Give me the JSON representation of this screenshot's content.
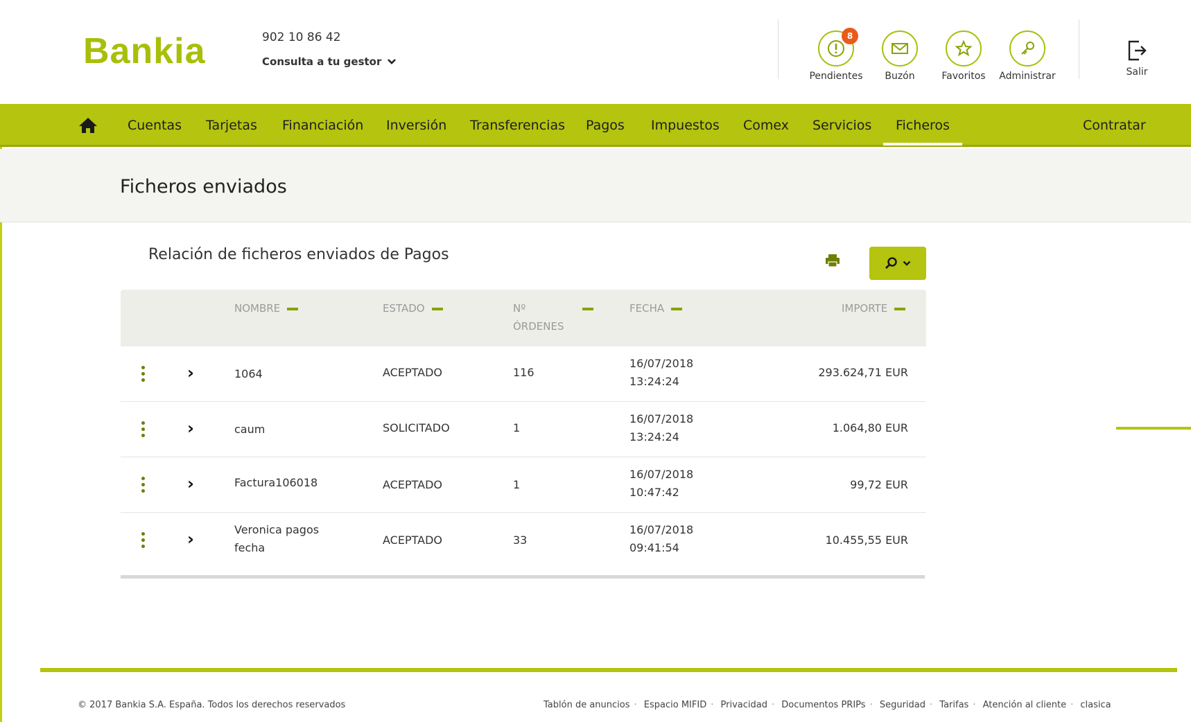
{
  "header": {
    "logo": "Bankia",
    "phone": "902 10 86 42",
    "gestor_label": "Consulta a tu gestor",
    "icons": [
      {
        "name": "pendientes-icon",
        "label": "Pendientes",
        "badge": "8"
      },
      {
        "name": "buzon-icon",
        "label": "Buzón"
      },
      {
        "name": "favoritos-icon",
        "label": "Favoritos"
      },
      {
        "name": "administrar-icon",
        "label": "Administrar"
      }
    ],
    "salir_label": "Salir"
  },
  "nav": {
    "items": [
      "Cuentas",
      "Tarjetas",
      "Financiación",
      "Inversión",
      "Transferencias",
      "Pagos",
      "Impuestos",
      "Comex",
      "Servicios",
      "Ficheros"
    ],
    "active": "Ficheros",
    "contratar": "Contratar"
  },
  "page": {
    "title": "Ficheros enviados",
    "section_title": "Relación de ficheros enviados de Pagos"
  },
  "table": {
    "headers": {
      "nombre": "NOMBRE",
      "estado": "ESTADO",
      "ordenes_line1": "Nº",
      "ordenes_line2": "ÓRDENES",
      "fecha": "FECHA",
      "importe": "IMPORTE"
    },
    "rows": [
      {
        "nombre_l1": "1064",
        "nombre_l2": "",
        "estado": "ACEPTADO",
        "ordenes": "116",
        "fecha": "16/07/2018",
        "hora": "13:24:24",
        "importe": "293.624,71 EUR"
      },
      {
        "nombre_l1": "caum",
        "nombre_l2": "",
        "estado": "SOLICITADO",
        "ordenes": "1",
        "fecha": "16/07/2018",
        "hora": "13:24:24",
        "importe": "1.064,80 EUR"
      },
      {
        "nombre_l1": "Factura106018",
        "nombre_l2": "",
        "estado": "ACEPTADO",
        "ordenes": "1",
        "fecha": "16/07/2018",
        "hora": "10:47:42",
        "importe": "99,72 EUR"
      },
      {
        "nombre_l1": "Veronica pagos",
        "nombre_l2": "fecha",
        "estado": "ACEPTADO",
        "ordenes": "33",
        "fecha": "16/07/2018",
        "hora": "09:41:54",
        "importe": "10.455,55 EUR"
      }
    ]
  },
  "footer": {
    "copyright": "© 2017 Bankia S.A. España. Todos los derechos reservados",
    "links": [
      "Tablón de anuncios",
      "Espacio MIFID",
      "Privacidad",
      "Documentos PRIPs",
      "Seguridad",
      "Tarifas",
      "Atención al cliente",
      "clasica"
    ]
  },
  "colors": {
    "brand_green": "#b4c40f",
    "badge_orange": "#e85b1c"
  }
}
